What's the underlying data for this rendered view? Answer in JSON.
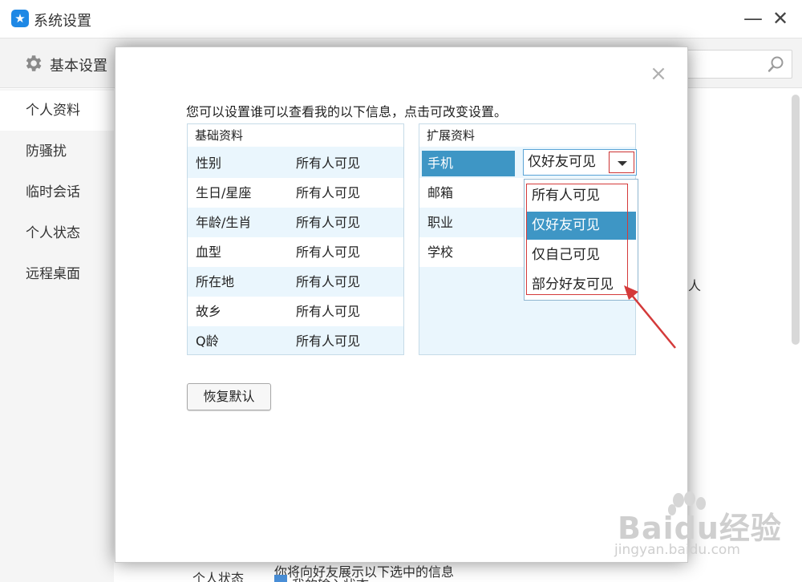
{
  "window": {
    "title": "系统设置",
    "minimize_glyph": "—",
    "close_glyph": "✕",
    "logo_glyph": "★"
  },
  "header": {
    "section_title": "基本设置"
  },
  "sidebar": {
    "items": [
      {
        "label": "个人资料",
        "active": true
      },
      {
        "label": "防骚扰",
        "active": false
      },
      {
        "label": "临时会话",
        "active": false
      },
      {
        "label": "个人状态",
        "active": false
      },
      {
        "label": "远程桌面",
        "active": false
      }
    ]
  },
  "background_fragments": {
    "right_edge": "人",
    "bottom_label": "个人状态",
    "bottom_text": "你将向好友展示以下选中的信息",
    "bottom_checkbox_text": "我的输入状态"
  },
  "dialog": {
    "close_glyph": "×",
    "instruction": "您可以设置谁可以查看我的以下信息，点击可改变设置。",
    "basic": {
      "header": "基础资料",
      "rows": [
        {
          "key": "性别",
          "value": "所有人可见"
        },
        {
          "key": "生日/星座",
          "value": "所有人可见"
        },
        {
          "key": "年龄/生肖",
          "value": "所有人可见"
        },
        {
          "key": "血型",
          "value": "所有人可见"
        },
        {
          "key": "所在地",
          "value": "所有人可见"
        },
        {
          "key": "故乡",
          "value": "所有人可见"
        },
        {
          "key": "Q龄",
          "value": "所有人可见"
        }
      ]
    },
    "extended": {
      "header": "扩展资料",
      "rows": [
        {
          "key": "手机",
          "selected": true
        },
        {
          "key": "邮箱",
          "selected": false
        },
        {
          "key": "职业",
          "selected": false
        },
        {
          "key": "学校",
          "selected": false
        }
      ]
    },
    "dropdown": {
      "value": "仅好友可见",
      "options": [
        "所有人可见",
        "仅好友可见",
        "仅自己可见",
        "部分好友可见"
      ],
      "selected_index": 1
    },
    "restore_button": "恢复默认"
  },
  "watermark": {
    "text": "Baidu经验",
    "url": "jingyan.baidu.com"
  },
  "colors": {
    "accent": "#3e96c5",
    "panel_bg": "#eaf6fd",
    "annotation_red": "#d43a3a"
  }
}
